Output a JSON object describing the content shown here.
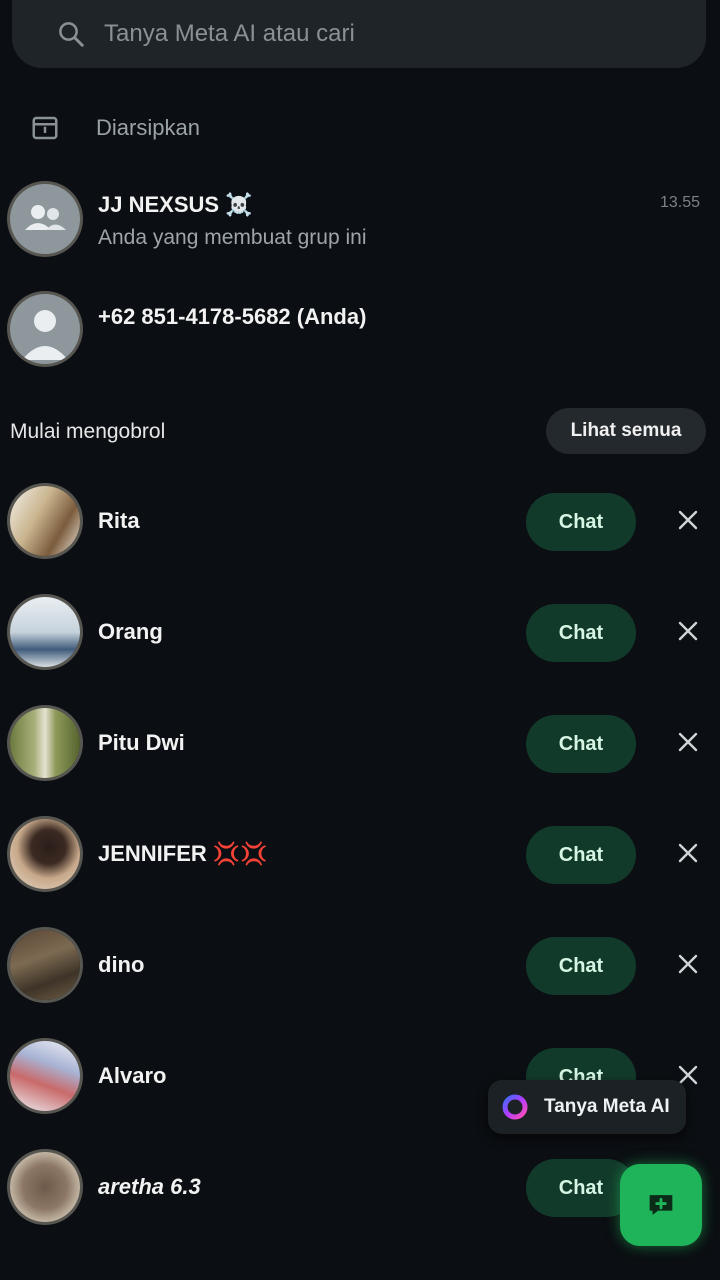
{
  "search": {
    "placeholder": "Tanya Meta AI atau cari"
  },
  "archived": {
    "label": "Diarsipkan"
  },
  "chats": [
    {
      "name": "JJ NEXSUS ☠️",
      "preview": "Anda yang membuat grup ini",
      "time": "13.55"
    },
    {
      "name": "+62 851-4178-5682 (Anda)"
    }
  ],
  "start_chat": {
    "title": "Mulai mengobrol",
    "see_all": "Lihat semua",
    "button_label": "Chat",
    "contacts": [
      {
        "name": "Rita"
      },
      {
        "name": "Orang"
      },
      {
        "name": "Pitu Dwi"
      },
      {
        "name": "JENNIFER 💢💢"
      },
      {
        "name": "dino"
      },
      {
        "name": "Alvaro"
      },
      {
        "name": "aretha 6.3"
      }
    ]
  },
  "meta_ai": {
    "label": "Tanya Meta AI"
  },
  "colors": {
    "accent": "#1fb35a",
    "chat_button_bg": "#123a2a",
    "background": "#0b0e12"
  }
}
